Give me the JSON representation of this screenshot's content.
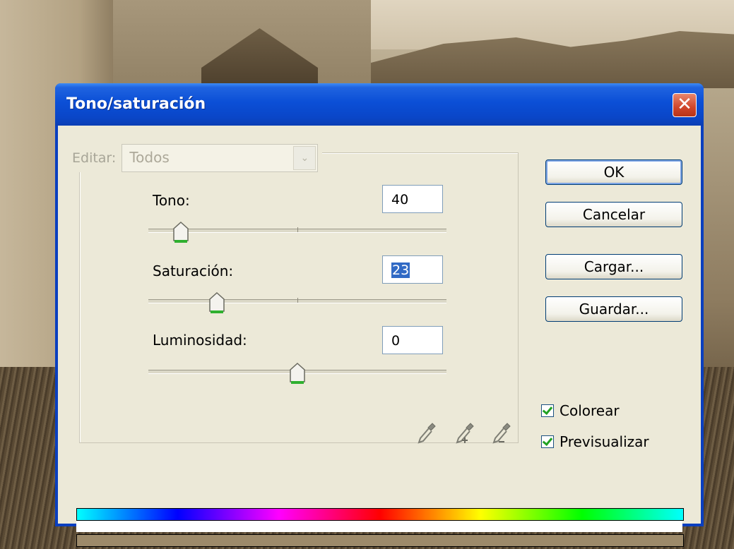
{
  "window": {
    "title": "Tono/saturación",
    "close_symbol": "✕"
  },
  "edit": {
    "label": "Editar:",
    "value": "Todos"
  },
  "hue": {
    "label": "Tono:",
    "value": "40",
    "slider_level": 0.11
  },
  "saturation": {
    "label": "Saturación:",
    "value": "23",
    "slider_level": 0.23
  },
  "lightness": {
    "label": "Luminosidad:",
    "value": "0",
    "slider_level": 0.5
  },
  "buttons": {
    "ok": "OK",
    "cancel": "Cancelar",
    "load": "Cargar...",
    "save": "Guardar..."
  },
  "checkboxes": {
    "colorize": {
      "label": "Colorear",
      "checked": true
    },
    "preview": {
      "label": "Previsualizar",
      "checked": true
    }
  },
  "icons": [
    "eyedropper-icon",
    "eyedropper-plus-icon",
    "eyedropper-minus-icon"
  ],
  "colors": {
    "title_bar": "#0b4fd6",
    "dialog_bg": "#ece9d8",
    "result_bar": "#9d8a6a",
    "selection": "#316ac5"
  }
}
